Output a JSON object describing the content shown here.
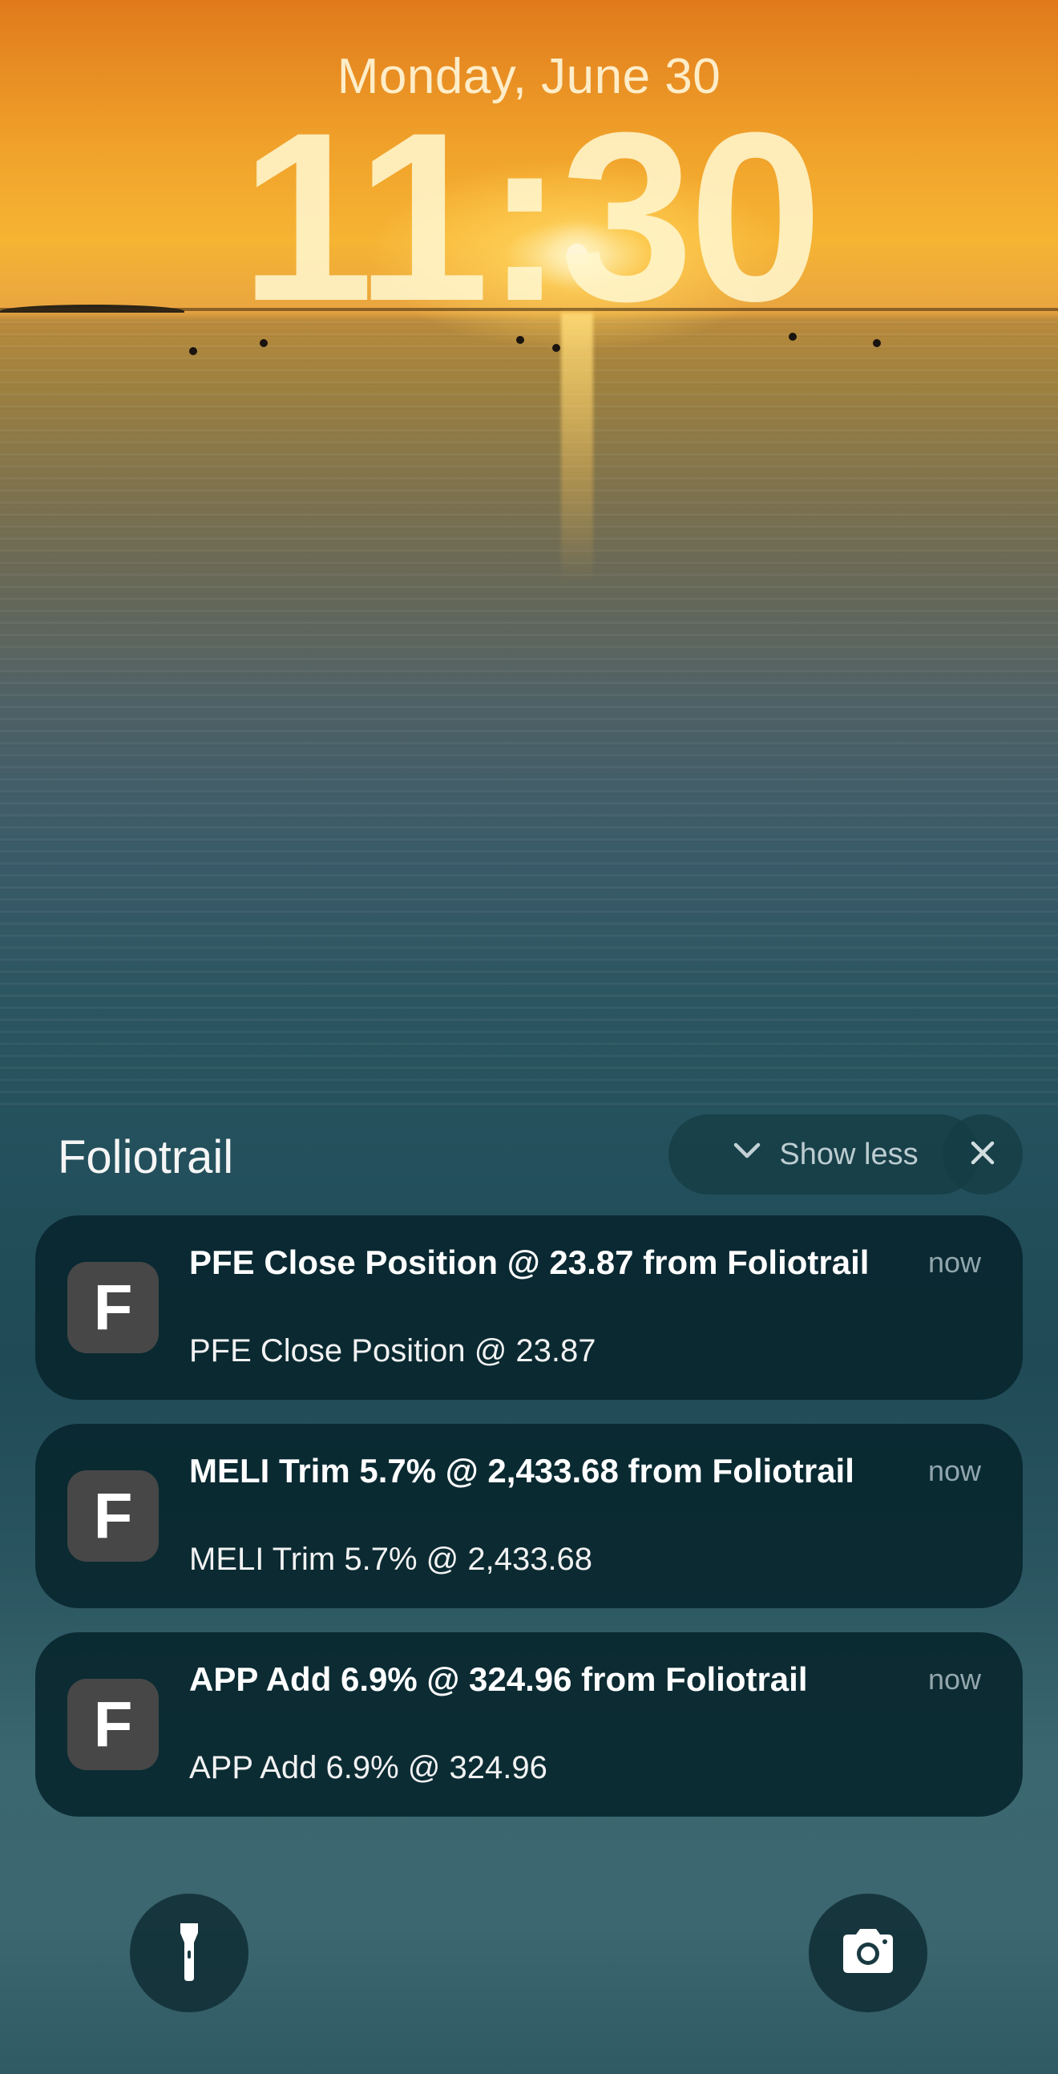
{
  "lock_screen": {
    "date": "Monday, June 30",
    "time": "11:30"
  },
  "notification_group": {
    "app_name": "Foliotrail",
    "show_less_label": "Show less",
    "notifications": [
      {
        "icon_letter": "F",
        "title": "PFE Close Position @ 23.87 from Foliotrail",
        "body": "PFE Close Position @ 23.87",
        "time": "now"
      },
      {
        "icon_letter": "F",
        "title": "MELI Trim 5.7% @ 2,433.68 from Foliotrail",
        "body": "MELI Trim 5.7% @ 2,433.68",
        "time": "now"
      },
      {
        "icon_letter": "F",
        "title": "APP Add 6.9% @ 324.96 from Foliotrail",
        "body": "APP Add 6.9% @ 324.96",
        "time": "now"
      }
    ]
  },
  "quick_actions": {
    "left": "flashlight-icon",
    "right": "camera-icon"
  },
  "colors": {
    "notification_bg": "#08262e",
    "app_icon_bg": "#474747"
  }
}
